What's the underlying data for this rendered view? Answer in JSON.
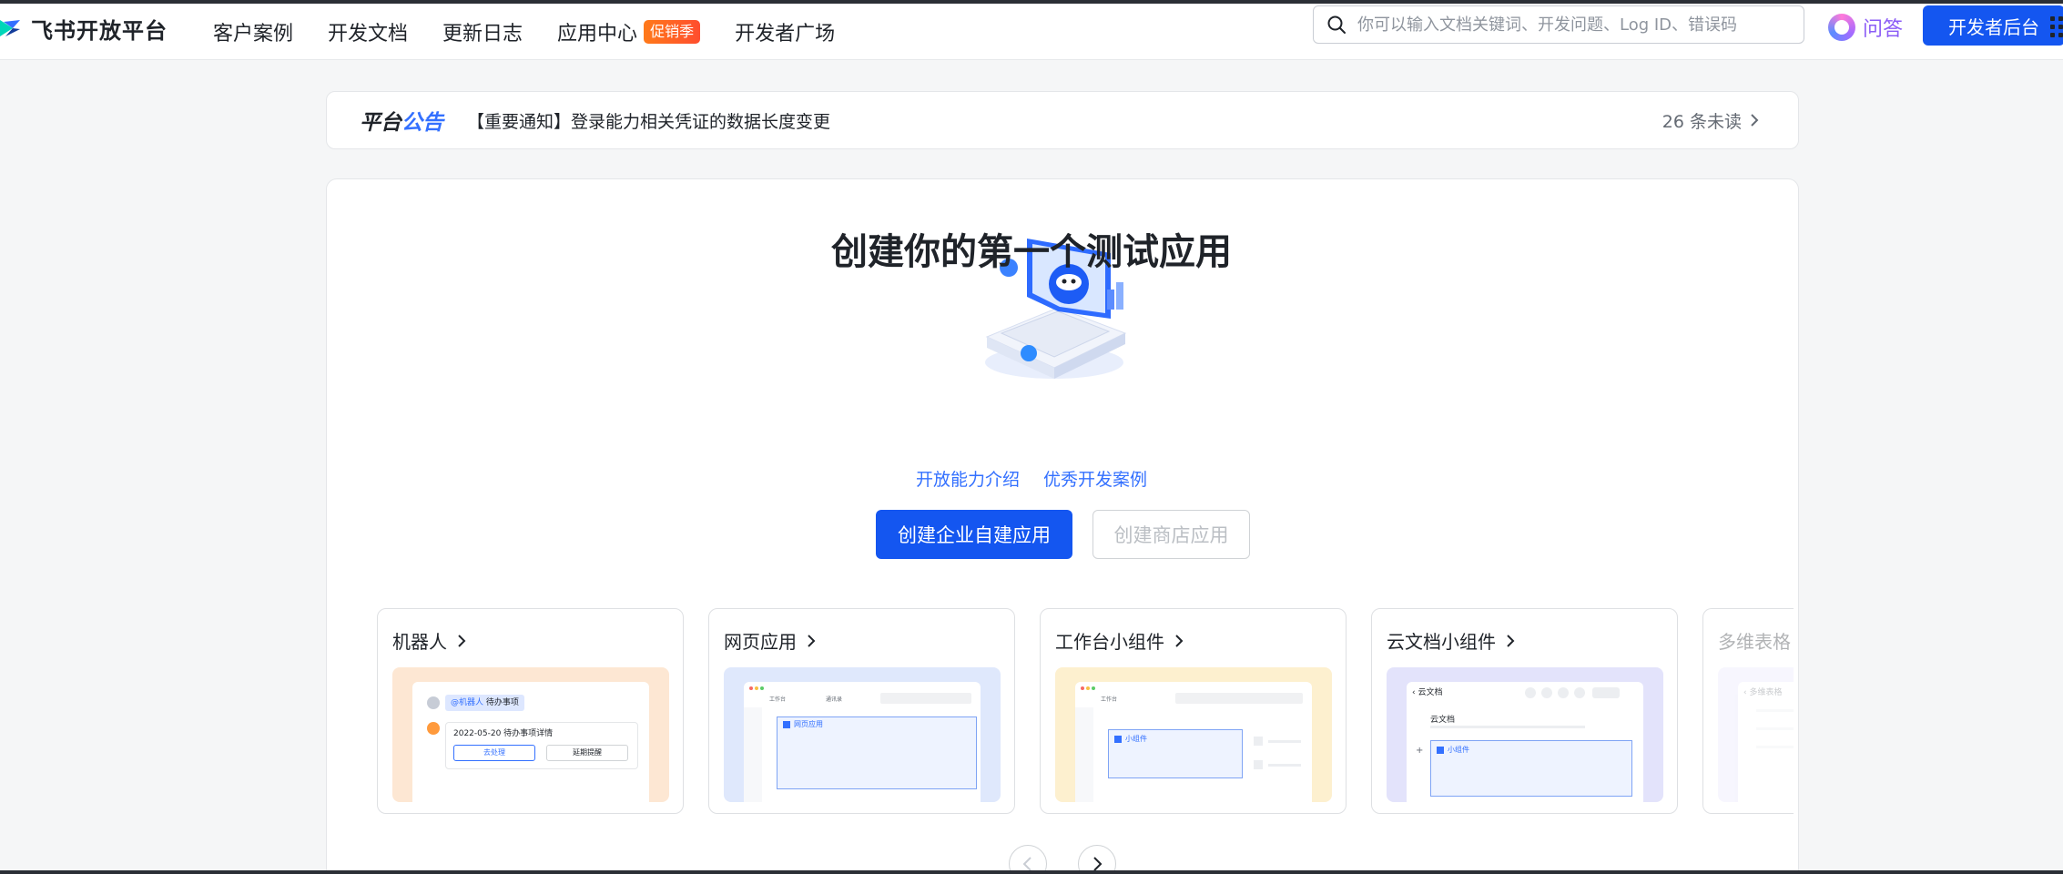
{
  "header": {
    "logo_text": "飞书开放平台",
    "nav": [
      {
        "label": "客户案例"
      },
      {
        "label": "开发文档"
      },
      {
        "label": "更新日志"
      },
      {
        "label": "应用中心",
        "badge": "促销季"
      },
      {
        "label": "开发者广场"
      }
    ],
    "search_placeholder": "你可以输入文档关键词、开发问题、Log ID、错误码",
    "qa_label": "问答",
    "dev_console_label": "开发者后台"
  },
  "notice": {
    "title_a": "平台",
    "title_b": "公告",
    "text": "【重要通知】登录能力相关凭证的数据长度变更",
    "unread": "26 条未读"
  },
  "hero": {
    "title": "创建你的第一个测试应用",
    "link_intro": "开放能力介绍",
    "link_cases": "优秀开发案例",
    "primary_button": "创建企业自建应用",
    "secondary_button": "创建商店应用"
  },
  "types": [
    {
      "title": "机器人",
      "mock": {
        "tag": "@机器人",
        "tag_text": "待办事项",
        "row": "2022-05-20 待办事项详情",
        "btn1": "去处理",
        "btn2": "延期提醒"
      }
    },
    {
      "title": "网页应用",
      "mock": {
        "tab1": "工作台",
        "tab2": "通讯录",
        "panel": "网页应用"
      }
    },
    {
      "title": "工作台小组件",
      "mock": {
        "tab1": "工作台",
        "panel": "小组件"
      }
    },
    {
      "title": "云文档小组件",
      "mock": {
        "head": "云文档",
        "sub": "云文档",
        "panel": "小组件"
      }
    },
    {
      "title": "多维表格",
      "mock": {
        "head": "多维表格"
      }
    }
  ],
  "colors": {
    "primary": "#1456f0",
    "link": "#3370ff",
    "badge": "#ff5a2a"
  }
}
